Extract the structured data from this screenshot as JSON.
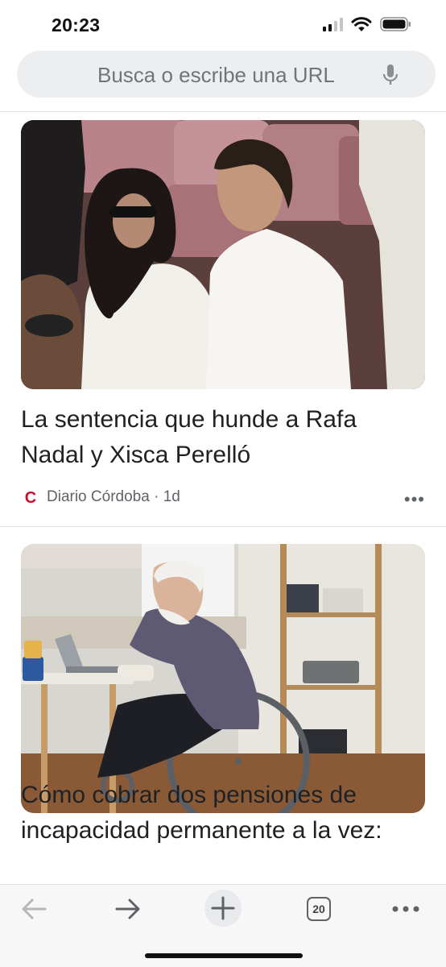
{
  "status_bar": {
    "time": "20:23",
    "icons": [
      "cellular-signal-icon",
      "wifi-icon",
      "battery-icon"
    ]
  },
  "address_bar": {
    "placeholder": "Busca o escribe una URL",
    "icon": "microphone-icon"
  },
  "feed": {
    "articles": [
      {
        "image": "photo-couple-in-stadium-stands",
        "title": "La sentencia que hunde a Rafa Nadal y Xisca Perelló",
        "source": "Diario Córdoba",
        "age": "1d",
        "source_logo": "C",
        "more_label": "•••"
      },
      {
        "image": "photo-elderly-man-wheelchair-laptop",
        "title": "Cómo cobrar dos pensiones de incapacidad permanente a la vez:"
      }
    ]
  },
  "toolbar": {
    "tab_count": "20",
    "icons": [
      "back-arrow-icon",
      "forward-arrow-icon",
      "new-tab-plus-icon",
      "tab-switcher-icon",
      "more-menu-icon"
    ]
  },
  "colors": {
    "source_logo": "#c8102e",
    "address_bar_bg": "#eceef0",
    "toolbar_bg": "#f7f7f7"
  }
}
